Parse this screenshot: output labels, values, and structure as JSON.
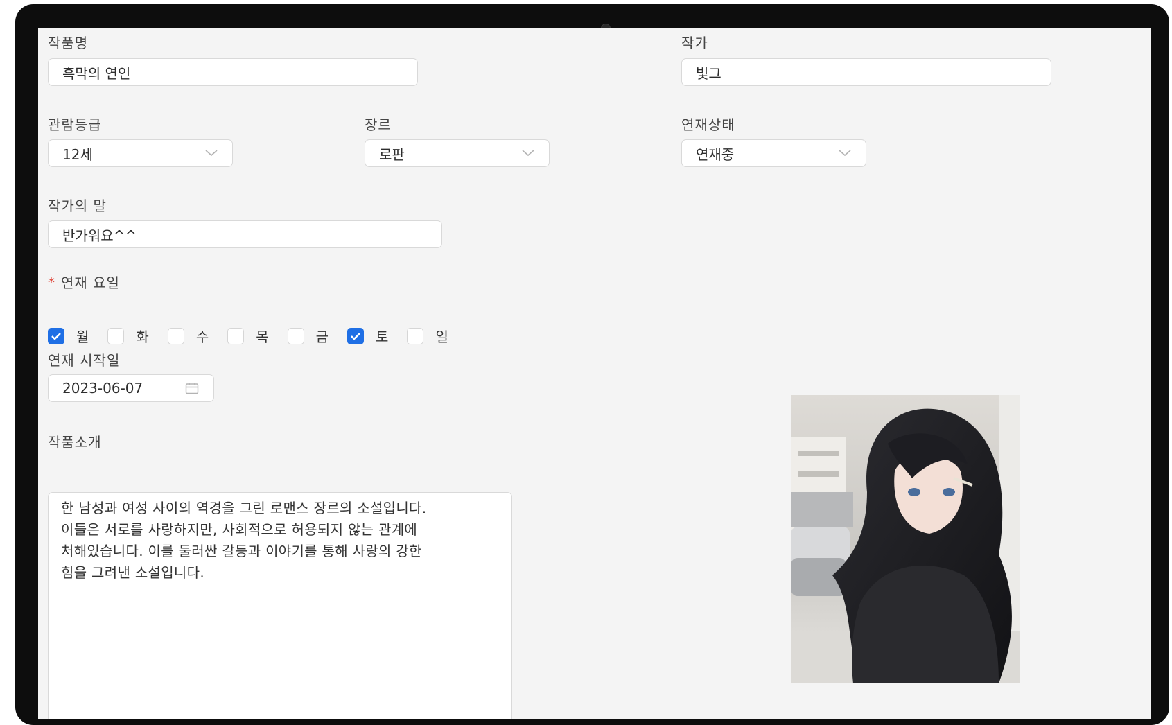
{
  "form": {
    "title_label": "작품명",
    "title_value": "흑막의 연인",
    "author_label": "작가",
    "author_value": "빛그",
    "rating_label": "관람등급",
    "rating_value": "12세",
    "genre_label": "장르",
    "genre_value": "로판",
    "status_label": "연재상태",
    "status_value": "연재중",
    "author_note_label": "작가의 말",
    "author_note_value": "반가워요^^",
    "days_label": "연재 요일",
    "days_required_mark": "*",
    "days": [
      {
        "label": "월",
        "checked": true
      },
      {
        "label": "화",
        "checked": false
      },
      {
        "label": "수",
        "checked": false
      },
      {
        "label": "목",
        "checked": false
      },
      {
        "label": "금",
        "checked": false
      },
      {
        "label": "토",
        "checked": true
      },
      {
        "label": "일",
        "checked": false
      }
    ],
    "start_date_label": "연재 시작일",
    "start_date_value": "2023-06-07",
    "intro_label": "작품소개",
    "intro_lines": [
      "한 남성과 여성 사이의 역경을 그린 로맨스 장르의 소설입니다.",
      "이들은 서로를 사랑하지만, 사회적으로 허용되지 않는 관계에",
      "처해있습니다. 이를 둘러싼 갈등과 이야기를 통해 사랑의 강한",
      "힘을 그려낸 소설입니다."
    ]
  },
  "icons": {
    "select_arrow": "chevron-down-icon",
    "date_picker": "calendar-icon",
    "checkbox_mark": "check-icon"
  },
  "colors": {
    "accent": "#1f6fe5",
    "required": "#e0473c",
    "screen_bg": "#f4f4f4",
    "bezel": "#0d0d0d"
  }
}
